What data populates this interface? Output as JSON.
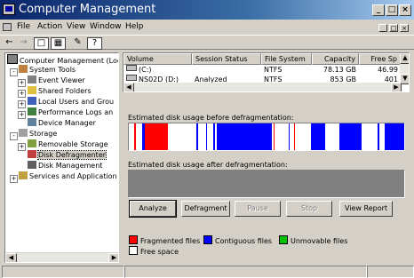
{
  "window": {
    "title": "Computer Management",
    "controls": [
      "_",
      "□",
      "×"
    ]
  },
  "menu": {
    "items": [
      "File",
      "Action",
      "View",
      "Window",
      "Help"
    ],
    "mdi_controls": [
      "_",
      "□",
      "×"
    ]
  },
  "toolbar": {
    "icons": [
      "back-arrow-icon",
      "forward-arrow-icon",
      "up-folder-icon",
      "show-hide-tree-icon",
      "properties-icon",
      "help-icon"
    ]
  },
  "tree": {
    "nodes": [
      {
        "label": "Computer Management (Loc",
        "icon": "computer-icon"
      },
      {
        "label": "System Tools",
        "icon": "tools-icon"
      },
      {
        "label": "Event Viewer",
        "icon": "event-viewer-icon"
      },
      {
        "label": "Shared Folders",
        "icon": "folder-icon"
      },
      {
        "label": "Local Users and Grou",
        "icon": "users-icon"
      },
      {
        "label": "Performance Logs an",
        "icon": "performance-icon"
      },
      {
        "label": "Device Manager",
        "icon": "device-manager-icon"
      },
      {
        "label": "Storage",
        "icon": "storage-icon"
      },
      {
        "label": "Removable Storage",
        "icon": "removable-storage-icon"
      },
      {
        "label": "Disk Defragmenter",
        "icon": "defrag-icon"
      },
      {
        "label": "Disk Management",
        "icon": "disk-management-icon"
      },
      {
        "label": "Services and Application",
        "icon": "services-icon"
      }
    ],
    "selected": "Disk Defragmenter"
  },
  "volumes": {
    "columns": [
      "Volume",
      "Session Status",
      "File System",
      "Capacity",
      "Free Sp"
    ],
    "rows": [
      {
        "volume": "(C:)",
        "status": "",
        "fs": "NTFS",
        "capacity": "78.13 GB",
        "free": "46.99"
      },
      {
        "volume": "NS02D (D:)",
        "status": "Analyzed",
        "fs": "NTFS",
        "capacity": "853 GB",
        "free": "401"
      }
    ]
  },
  "defrag": {
    "before_label": "Estimated disk usage before defragmentation:",
    "after_label": "Estimated disk usage after defragmentation:",
    "buttons": {
      "analyze": "Analyze",
      "defragment": "Defragment",
      "pause": "Pause",
      "stop": "Stop",
      "view_report": "View Report"
    },
    "legend": {
      "fragmented": "Fragmented files",
      "contiguous": "Contiguous files",
      "unmovable": "Unmovable files",
      "free": "Free space"
    },
    "colors": {
      "fragmented": "#ff0000",
      "contiguous": "#0000ff",
      "unmovable": "#00c000",
      "free": "#ffffff",
      "after_empty": "#808080"
    }
  },
  "colors": {
    "titlebar": "#0a246a",
    "face": "#d4d0c8"
  }
}
